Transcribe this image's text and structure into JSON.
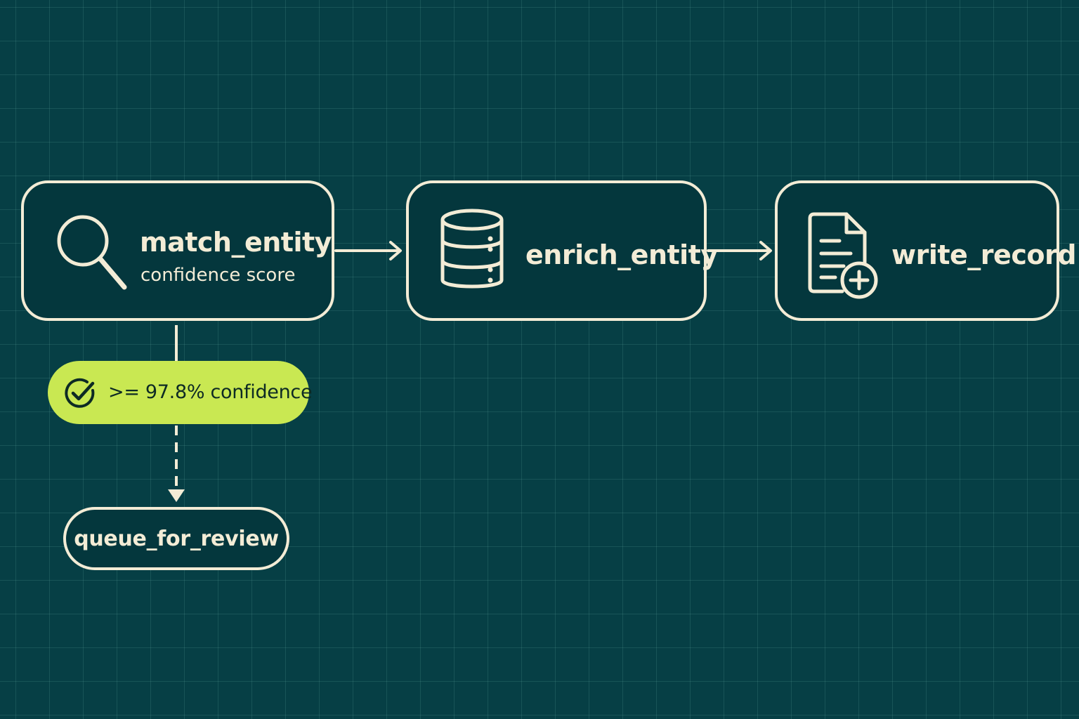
{
  "diagram": {
    "nodes": [
      {
        "id": "match_entity",
        "title": "match_entity",
        "subtitle": "confidence score",
        "icon": "search-icon"
      },
      {
        "id": "enrich_entity",
        "title": "enrich_entity",
        "icon": "database-icon"
      },
      {
        "id": "write_record",
        "title": "write_record",
        "icon": "document-add-icon"
      }
    ],
    "condition": {
      "label": ">= 97.8% confidence",
      "icon": "check-circle-icon"
    },
    "review": {
      "label": "queue_for_review"
    },
    "edges": [
      {
        "from": "match_entity",
        "to": "enrich_entity",
        "style": "solid"
      },
      {
        "from": "enrich_entity",
        "to": "write_record",
        "style": "solid"
      },
      {
        "from": "match_entity",
        "to": "queue_for_review",
        "style": "dashed"
      }
    ]
  },
  "colors": {
    "background": "#063f45",
    "node_fill": "#04373d",
    "stroke": "#f3ecd6",
    "condition_fill": "#c9e852",
    "condition_text": "#0d2a24"
  }
}
